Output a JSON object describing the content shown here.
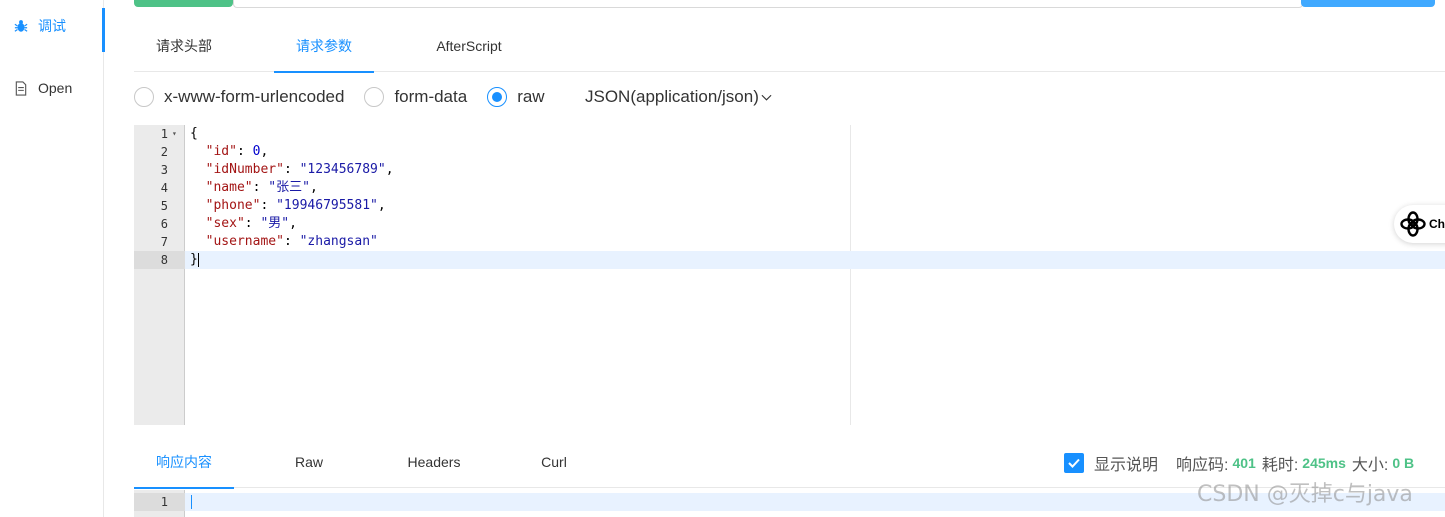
{
  "sidebar": {
    "items": [
      {
        "label": "调试",
        "icon": "bug-icon",
        "active": true
      },
      {
        "label": "Open",
        "icon": "document-icon",
        "active": false
      }
    ]
  },
  "request_tabs": [
    {
      "label": "请求头部",
      "active": false
    },
    {
      "label": "请求参数",
      "active": true
    },
    {
      "label": "AfterScript",
      "active": false
    }
  ],
  "body_types": [
    {
      "label": "x-www-form-urlencoded",
      "checked": false
    },
    {
      "label": "form-data",
      "checked": false
    },
    {
      "label": "raw",
      "checked": true
    }
  ],
  "content_type": "JSON(application/json)",
  "editor": {
    "active_line": 8,
    "lines": [
      {
        "num": "1",
        "text": "{"
      },
      {
        "num": "2",
        "text": "  \"id\": 0,"
      },
      {
        "num": "3",
        "text": "  \"idNumber\": \"123456789\","
      },
      {
        "num": "4",
        "text": "  \"name\": \"张三\","
      },
      {
        "num": "5",
        "text": "  \"phone\": \"19946795581\","
      },
      {
        "num": "6",
        "text": "  \"sex\": \"男\","
      },
      {
        "num": "7",
        "text": "  \"username\": \"zhangsan\""
      },
      {
        "num": "8",
        "text": "}"
      }
    ]
  },
  "float_widget": {
    "label": "Cha",
    "icon": "chatgpt-icon"
  },
  "response_tabs": [
    {
      "label": "响应内容",
      "active": true
    },
    {
      "label": "Raw",
      "active": false
    },
    {
      "label": "Headers",
      "active": false
    },
    {
      "label": "Curl",
      "active": false
    }
  ],
  "response_meta": {
    "show_desc_label": "显示说明",
    "show_desc_checked": true,
    "status_key": "响应码:",
    "status_value": "401",
    "time_key": "耗时:",
    "time_value": "245ms",
    "size_key": "大小:",
    "size_value": "0 B"
  },
  "response_editor": {
    "line_num": "1"
  },
  "watermark": "CSDN @灭掉c与java",
  "colors": {
    "accent": "#1890ff",
    "success": "#4ec287"
  }
}
